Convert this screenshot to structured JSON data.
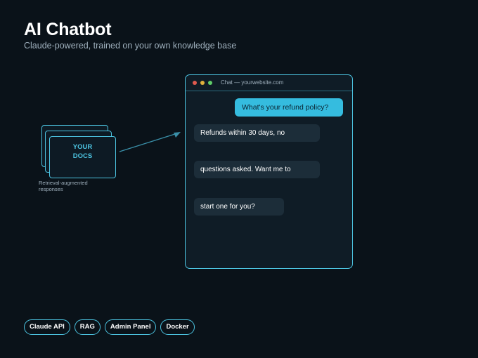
{
  "header": {
    "title": "AI Chatbot",
    "subtitle": "Claude-powered, trained on your own knowledge base"
  },
  "docs": {
    "label_line1": "YOUR",
    "label_line2": "DOCS",
    "caption_line1": "Retrieval-augmented",
    "caption_line2": "responses"
  },
  "chat_window": {
    "title": "Chat — yourwebsite.com",
    "messages": [
      {
        "role": "user",
        "text": "What's your refund policy?"
      },
      {
        "role": "bot",
        "text": "Refunds within 30 days, no"
      },
      {
        "role": "bot",
        "text": "questions asked. Want me to"
      },
      {
        "role": "bot",
        "text": "start one for you?"
      }
    ]
  },
  "tags": [
    "Claude API",
    "RAG",
    "Admin Panel",
    "Docker"
  ],
  "colors": {
    "background": "#0a1219",
    "accent": "#4cc3e0",
    "user_bubble": "#35bcdf",
    "bot_bubble": "#1c2d39"
  }
}
